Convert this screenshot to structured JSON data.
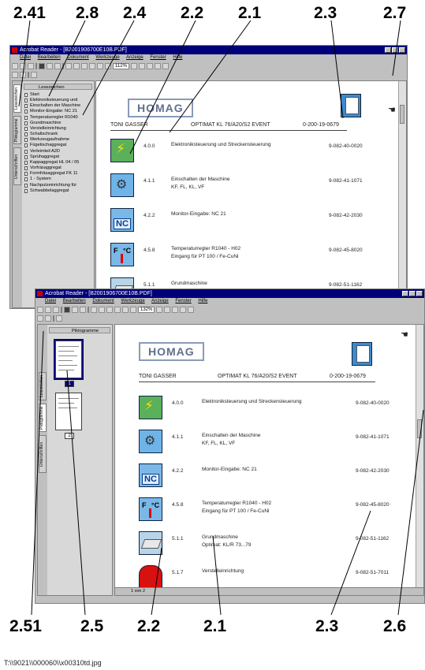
{
  "callouts": {
    "top": [
      "2.41",
      "2.8",
      "2.4",
      "2.2",
      "2.1",
      "2.3",
      "2.7"
    ],
    "bottom": [
      "2.51",
      "2.5",
      "2.2",
      "2.1",
      "2.3",
      "2.6"
    ]
  },
  "window1": {
    "title": "Acrobat Reader - [B2001906700E10B.PDF]",
    "menu": [
      "Datei",
      "Bearbeiten",
      "Dokument",
      "Werkzeuge",
      "Anzeige",
      "Fenster",
      "Hilfe"
    ],
    "zoom": "112%",
    "nav_header": "Lesezeichen",
    "nav_tabs": [
      "Lesezeichen",
      "Piktogramme",
      "Unterschriften"
    ],
    "bookmarks": [
      "Start",
      "Elektroniksteuerung und",
      "Einschalten der Maschine",
      "Monitor-Eingabe: NC 21",
      "Temperaturregler R1040",
      "Grundmaschine",
      "Verstelleinrichtung",
      "Schaltschrank",
      "Werkzeugaufnahme",
      "Fügetischaggregat",
      "Verleimteil A2D",
      "Sprühaggregat",
      "Kappaggregat HL 04 / 05",
      "Vorfräsaggregat",
      "Formfräsaggregat FK 11",
      "1 - System",
      "Nachputzeinrichtung für",
      "Schwabbelaggregat"
    ]
  },
  "window2": {
    "title": "Acrobat Reader - [B2001906700E10B.PDF]",
    "menu": [
      "Datei",
      "Bearbeiten",
      "Dokument",
      "Werkzeuge",
      "Anzeige",
      "Fenster",
      "Hilfe"
    ],
    "zoom": "132%",
    "nav_header": "Piktogramme",
    "nav_tabs": [
      "Lesezeichen",
      "Piktogramme",
      "Unterschriften"
    ],
    "thumb_pages": [
      "1",
      "2"
    ],
    "status_page": "1 von 2"
  },
  "document": {
    "logo": "HOMAG",
    "header_left": "TONI GASSER",
    "header_mid": "OPTIMAT KL 76/A20/S2 EVENT",
    "header_right": "0-200-19-0679",
    "rows": [
      {
        "num": "4.0.0",
        "desc1": "Elektroniksteuerung und Streckensteuerung",
        "desc2": "",
        "code": "9-082-40-0020",
        "icon": "lightning"
      },
      {
        "num": "4.1.1",
        "desc1": "Einschalten der Maschine",
        "desc2": "KF, FL, KL, VF",
        "code": "9-082-41-1071",
        "icon": "tool"
      },
      {
        "num": "4.2.2",
        "desc1": "Monitor-Eingabe: NC 21",
        "desc2": "",
        "code": "9-082-42-2030",
        "icon": "nc"
      },
      {
        "num": "4.5.8",
        "desc1": "Temperaturregler R1040 - H02",
        "desc2": "Eingang für PT 100 / Fe-CuNi",
        "code": "9-082-45-8020",
        "icon": "temp"
      },
      {
        "num": "5.1.1",
        "desc1": "Grundmaschine",
        "desc2": "Optimat: KL/R 73...79",
        "code": "9-082-51-1162",
        "icon": "machine"
      },
      {
        "num": "5.1.7",
        "desc1": "Verstelleinrichtung",
        "desc2": "",
        "code": "9-082-51-7011",
        "icon": "red"
      }
    ],
    "nc_text": "NC",
    "temp_f": "F",
    "temp_c": "°C"
  },
  "caption": "T:\\\\9021\\\\000060\\\\x00310td.jpg"
}
